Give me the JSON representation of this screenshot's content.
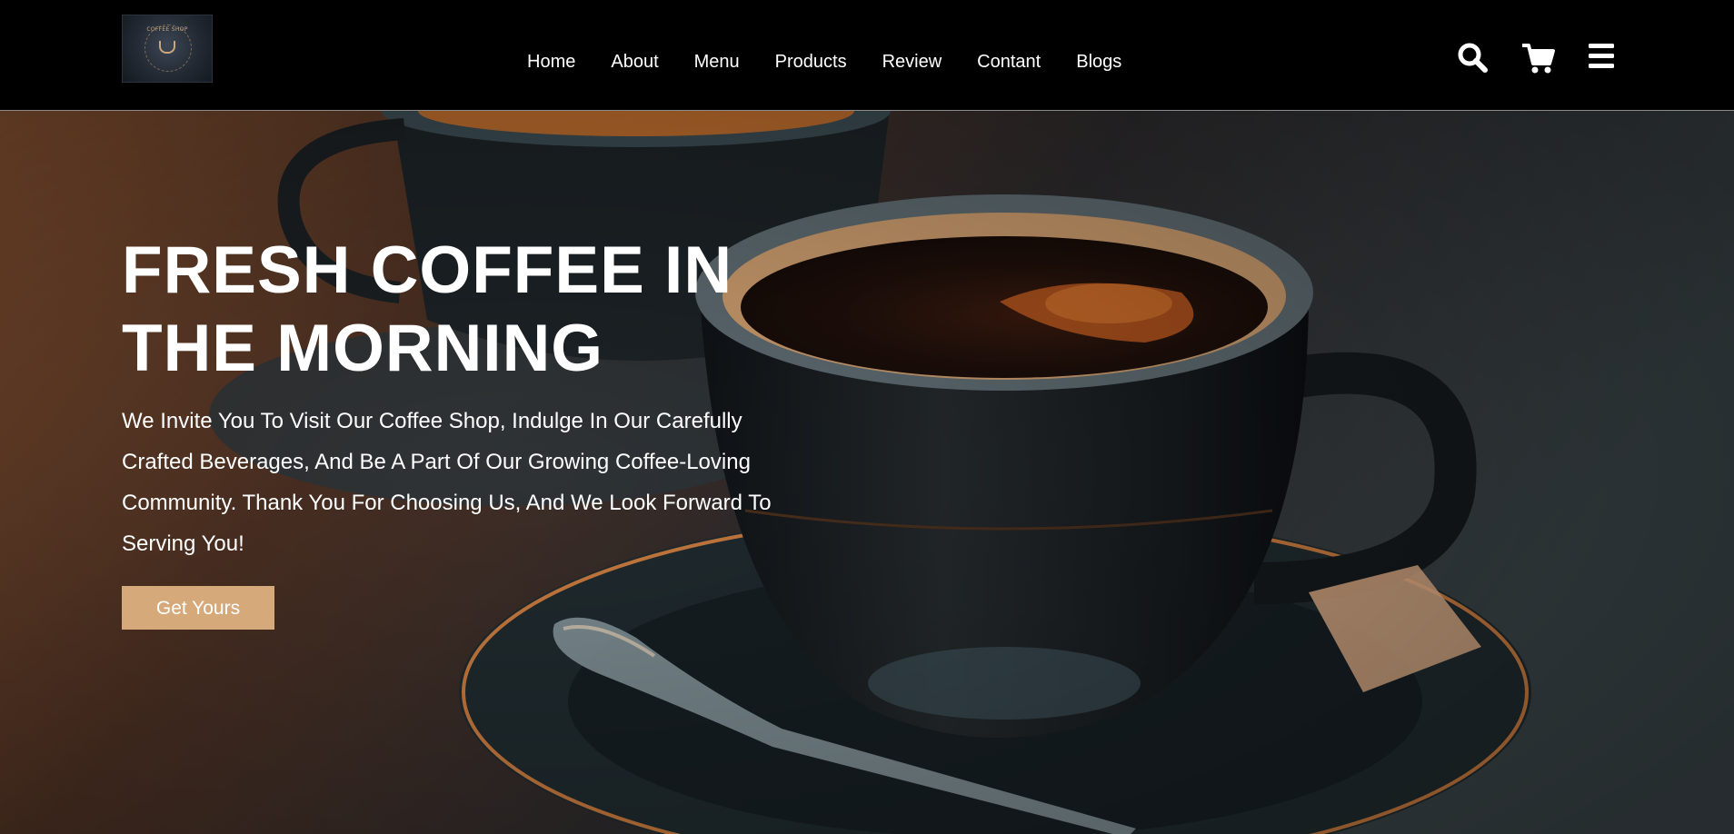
{
  "brand": {
    "logo_text": "COFFEE SHOP"
  },
  "nav": {
    "links": [
      "Home",
      "About",
      "Menu",
      "Products",
      "Review",
      "Contant",
      "Blogs"
    ]
  },
  "icons": {
    "search": "search-icon",
    "cart": "cart-icon",
    "menu": "hamburger-menu-icon"
  },
  "hero": {
    "title": "FRESH COFFEE IN THE MORNING",
    "text": "We Invite You To Visit Our Coffee Shop, Indulge In Our Carefully Crafted Beverages, And Be A Part Of Our Growing Coffee-Loving Community. Thank You For Choosing Us, And We Look Forward To Serving You!",
    "button_label": "Get Yours"
  },
  "colors": {
    "nav_background": "#000000",
    "accent": "#d5a97a",
    "text": "#ffffff"
  }
}
